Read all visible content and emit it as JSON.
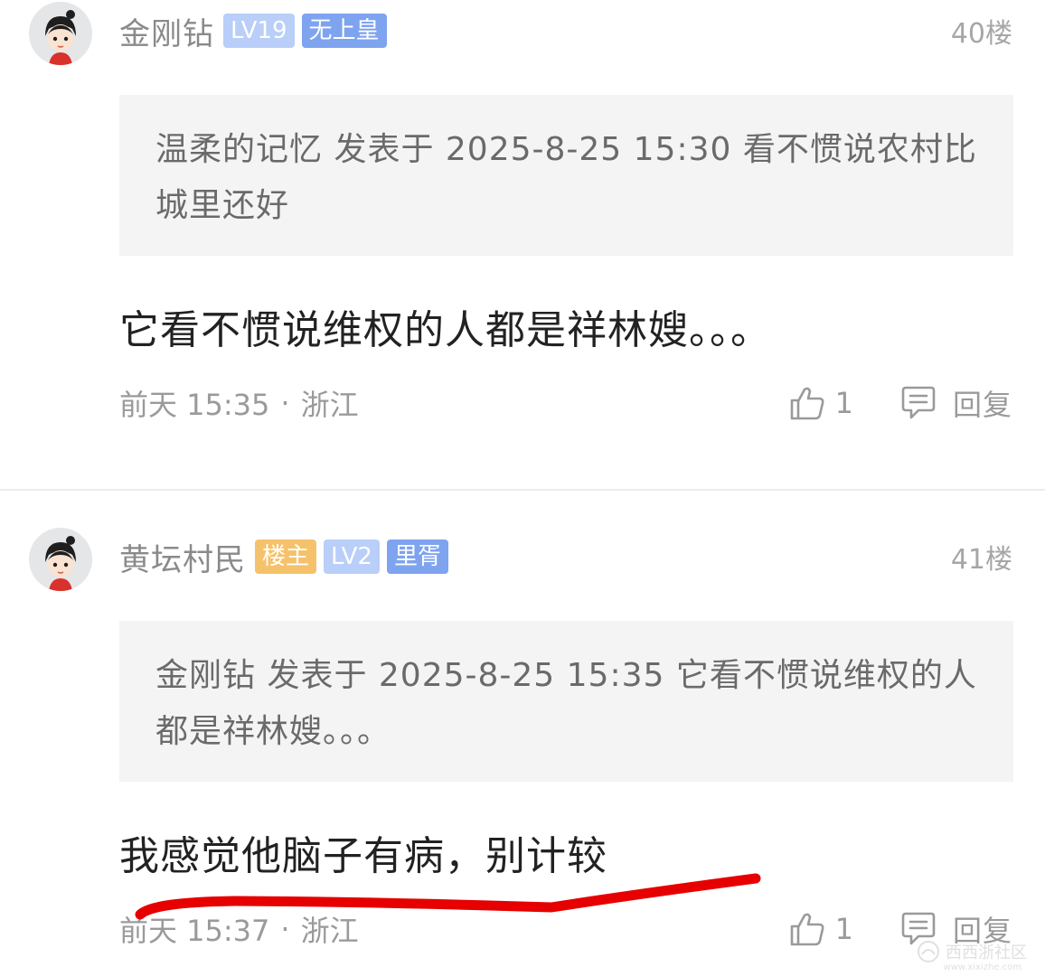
{
  "posts": [
    {
      "username": "金刚钻",
      "badges": [
        "LV19",
        "无上皇"
      ],
      "floor": "40楼",
      "quote": "温柔的记忆 发表于 2025-8-25 15:30 看不惯说农村比城里还好",
      "body": "它看不惯说维权的人都是祥林嫂。。。",
      "time": "前天 15:35",
      "location": "浙江",
      "likes": "1",
      "reply_label": "回复"
    },
    {
      "username": "黄坛村民",
      "badges": [
        "楼主",
        "LV2",
        "里胥"
      ],
      "floor": "41楼",
      "quote": "金刚钻 发表于 2025-8-25 15:35 它看不惯说维权的人都是祥林嫂。。。",
      "body": "我感觉他脑子有病，别计较",
      "time": "前天 15:37",
      "location": "浙江",
      "likes": "1",
      "reply_label": "回复"
    }
  ],
  "separator": "·",
  "colors": {
    "badge_level": "#b9cef8",
    "badge_title": "#7ea3ef",
    "badge_owner": "#f5c26b",
    "quote_bg": "#f4f4f4",
    "annotation_stroke": "#e60000"
  },
  "watermark": {
    "text": "西西浙社区",
    "sub": "www.xixizhe.com"
  }
}
